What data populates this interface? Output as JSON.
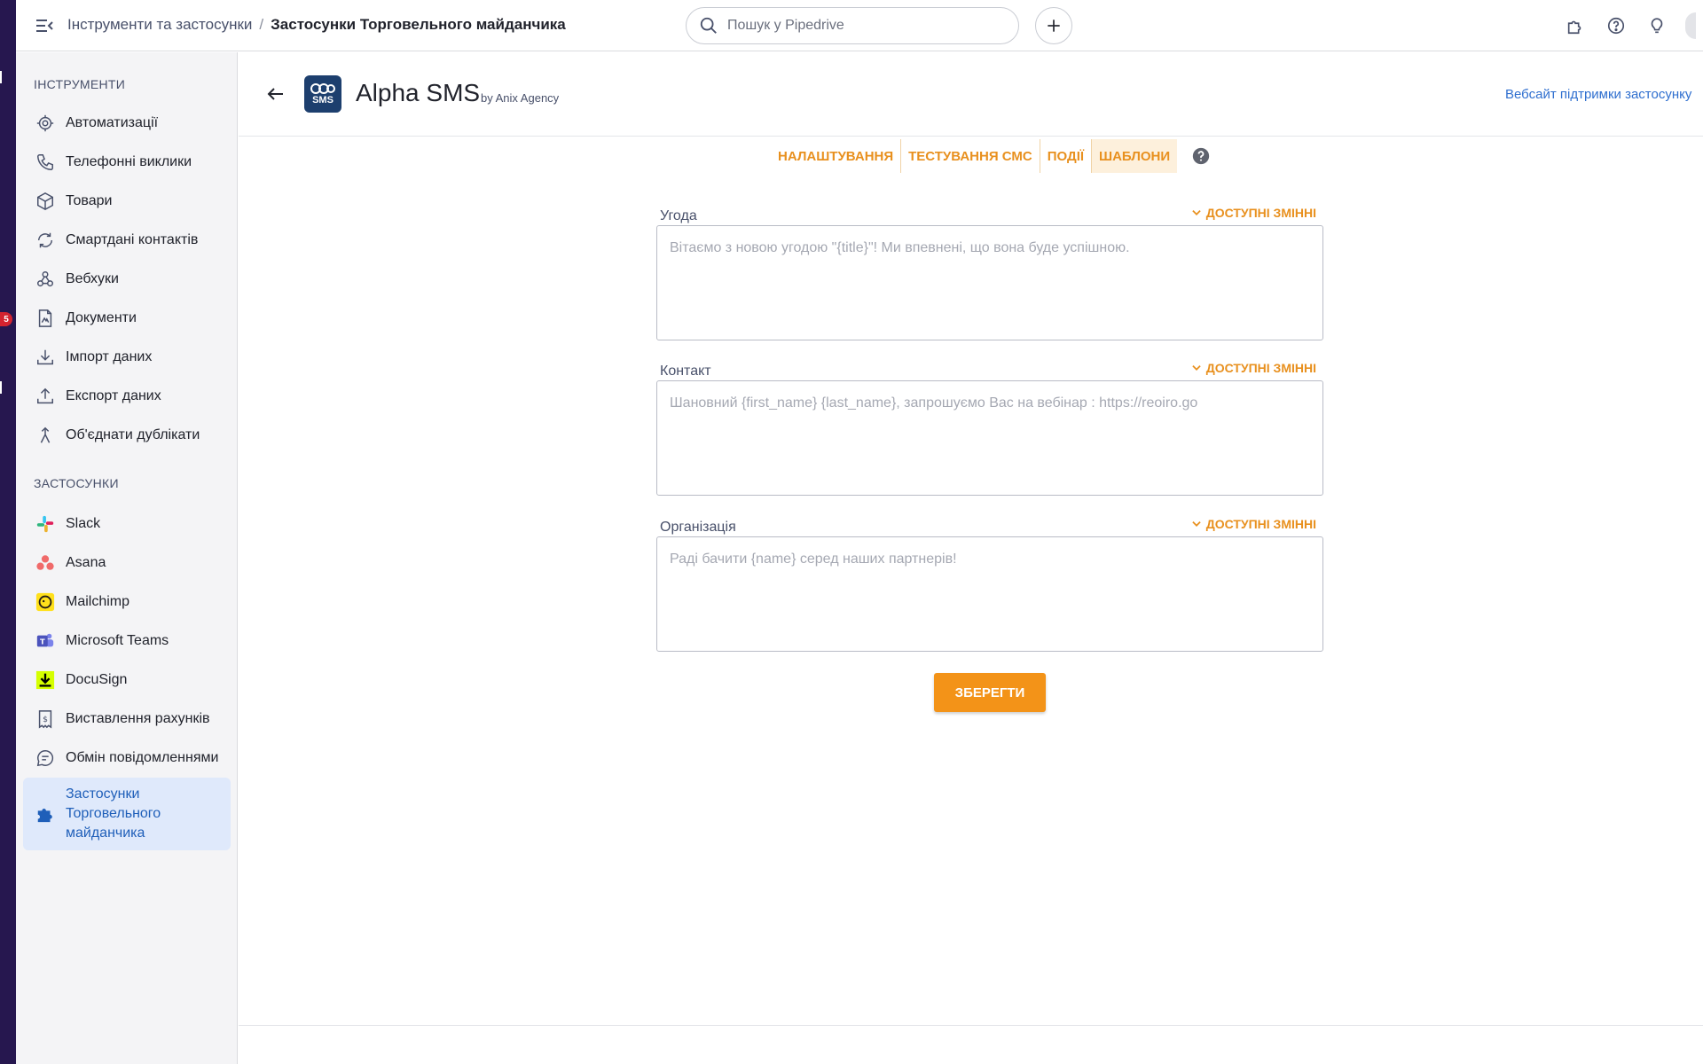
{
  "rail": {
    "badge_count": "5"
  },
  "header": {
    "breadcrumb_parent": "Інструменти та застосунки",
    "breadcrumb_sep": "/",
    "breadcrumb_current": "Застосунки Торговельного майданчика",
    "search_placeholder": "Пошук у Pipedrive"
  },
  "sidebar": {
    "tools_title": "ІНСТРУМЕНТИ",
    "tools": [
      {
        "label": "Автоматизації",
        "icon": "automation-icon"
      },
      {
        "label": "Телефонні виклики",
        "icon": "phone-icon"
      },
      {
        "label": "Товари",
        "icon": "box-icon"
      },
      {
        "label": "Смартдані контактів",
        "icon": "sync-icon"
      },
      {
        "label": "Вебхуки",
        "icon": "webhook-icon"
      },
      {
        "label": "Документи",
        "icon": "document-icon"
      },
      {
        "label": "Імпорт даних",
        "icon": "import-icon"
      },
      {
        "label": "Експорт даних",
        "icon": "export-icon"
      },
      {
        "label": "Об'єднати дублікати",
        "icon": "merge-icon"
      }
    ],
    "apps_title": "ЗАСТОСУНКИ",
    "apps": [
      {
        "label": "Slack",
        "icon": "slack-icon"
      },
      {
        "label": "Asana",
        "icon": "asana-icon"
      },
      {
        "label": "Mailchimp",
        "icon": "mailchimp-icon"
      },
      {
        "label": "Microsoft Teams",
        "icon": "teams-icon"
      },
      {
        "label": "DocuSign",
        "icon": "docusign-icon"
      },
      {
        "label": "Виставлення рахунків",
        "icon": "invoice-icon"
      },
      {
        "label": "Обмін повідомленнями",
        "icon": "message-icon"
      }
    ],
    "active_item": "Застосунки Торговельного майданчика"
  },
  "app": {
    "logo_text": "SMS",
    "title": "Alpha SMS",
    "by": "by Anix Agency",
    "support_link": "Вебсайт підтримки застосунку"
  },
  "tabs": [
    {
      "label": "НАЛАШТУВАННЯ",
      "active": false
    },
    {
      "label": "ТЕСТУВАННЯ СМС",
      "active": false
    },
    {
      "label": "ПОДІЇ",
      "active": false
    },
    {
      "label": "ШАБЛОНИ",
      "active": true
    }
  ],
  "templates": [
    {
      "label": "Угода",
      "vars_label": "ДОСТУПНІ ЗМІННІ",
      "value": "",
      "placeholder": "Вітаємо з новою угодою \"{title}\"! Ми впевнені, що вона буде успішною."
    },
    {
      "label": "Контакт",
      "vars_label": "ДОСТУПНІ ЗМІННІ",
      "value": "",
      "placeholder": "Шановний {first_name} {last_name}, запрошуємо Вас на вебінар : https://reoiro.go"
    },
    {
      "label": "Організація",
      "vars_label": "ДОСТУПНІ ЗМІННІ",
      "value": "",
      "placeholder": "Раді бачити {name} серед наших партнерів!"
    }
  ],
  "save_label": "ЗБЕРЕГТИ",
  "colors": {
    "accent": "#f39318",
    "link": "#2f6fcf",
    "active_nav_bg": "#dfe9fb",
    "rail": "#26174f"
  }
}
